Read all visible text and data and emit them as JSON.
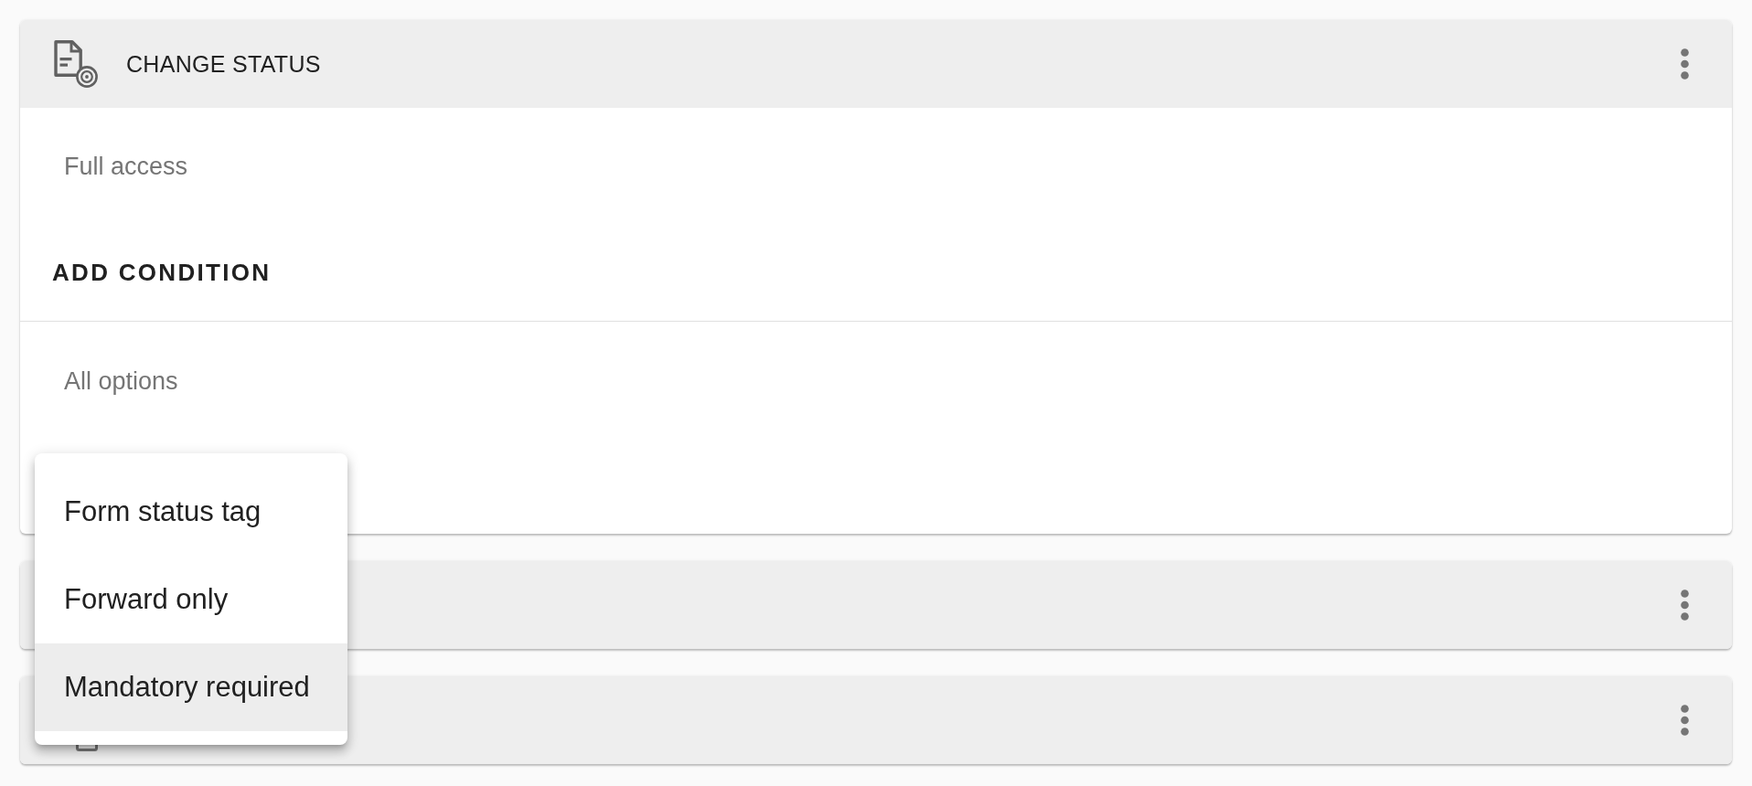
{
  "panels": [
    {
      "title": "CHANGE STATUS",
      "expanded": true,
      "icon": true,
      "access": "Full access",
      "action": "ADD CONDITION",
      "condition": "All options"
    },
    {
      "expanded": false,
      "icon": false
    },
    {
      "expanded": false,
      "icon": true
    }
  ],
  "menu": {
    "items": [
      {
        "label": "Form status tag",
        "selected": false
      },
      {
        "label": "Forward only",
        "selected": false
      },
      {
        "label": "Mandatory required",
        "selected": true
      }
    ]
  }
}
